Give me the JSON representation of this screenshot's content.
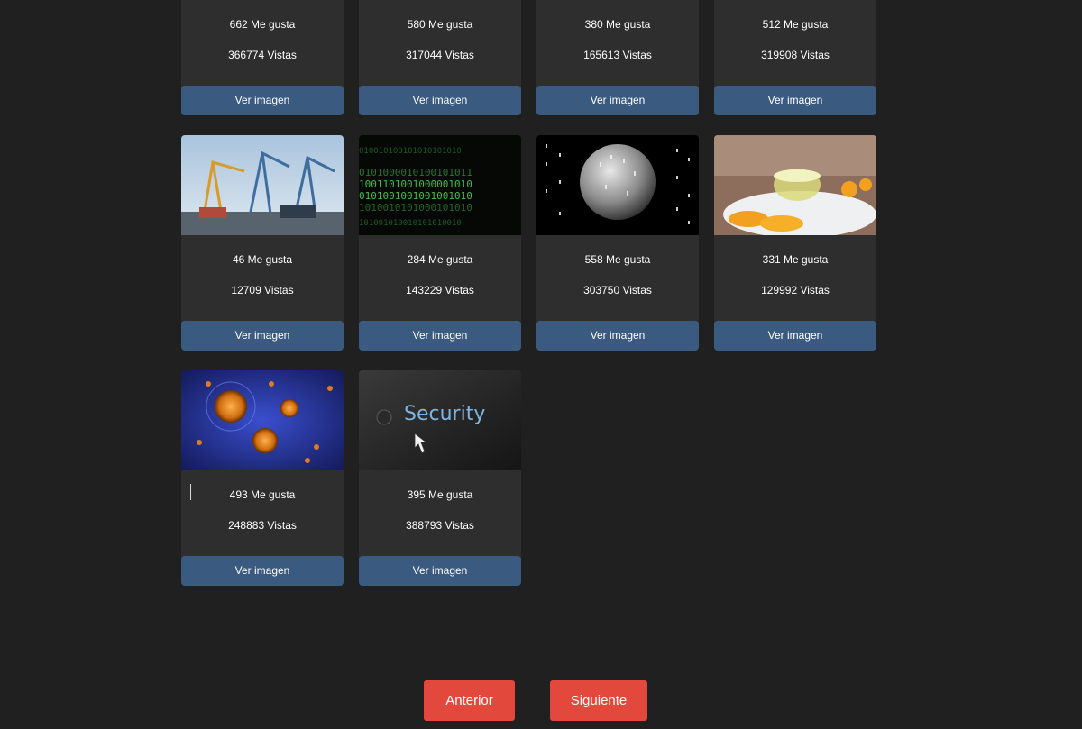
{
  "gallery": {
    "button_label": "Ver imagen",
    "cards": [
      {
        "likes": "662 Me gusta",
        "views": "366774 Vistas",
        "image": "sun-photo"
      },
      {
        "likes": "580 Me gusta",
        "views": "317044 Vistas",
        "image": "water-drop-photo"
      },
      {
        "likes": "380 Me gusta",
        "views": "165613 Vistas",
        "image": "railway-tracks-photo"
      },
      {
        "likes": "512 Me gusta",
        "views": "319908 Vistas",
        "image": "solar-panels-photo"
      },
      {
        "likes": "46 Me gusta",
        "views": "12709 Vistas",
        "image": "harbor-cranes-photo"
      },
      {
        "likes": "284 Me gusta",
        "views": "143229 Vistas",
        "image": "binary-code-photo"
      },
      {
        "likes": "558 Me gusta",
        "views": "303750 Vistas",
        "image": "binary-sphere-photo"
      },
      {
        "likes": "331 Me gusta",
        "views": "129992 Vistas",
        "image": "lemon-tea-photo"
      },
      {
        "likes": "493 Me gusta",
        "views": "248883 Vistas",
        "image": "virus-cells-photo"
      },
      {
        "likes": "395 Me gusta",
        "views": "388793 Vistas",
        "image": "security-button-photo"
      }
    ]
  },
  "security_thumb_text": "Security",
  "pagination": {
    "prev_label": "Anterior",
    "next_label": "Siguiente"
  },
  "colors": {
    "background": "#202020",
    "card": "#2e2e2e",
    "card_button": "#3b5a80",
    "pager_button": "#e2483c"
  }
}
